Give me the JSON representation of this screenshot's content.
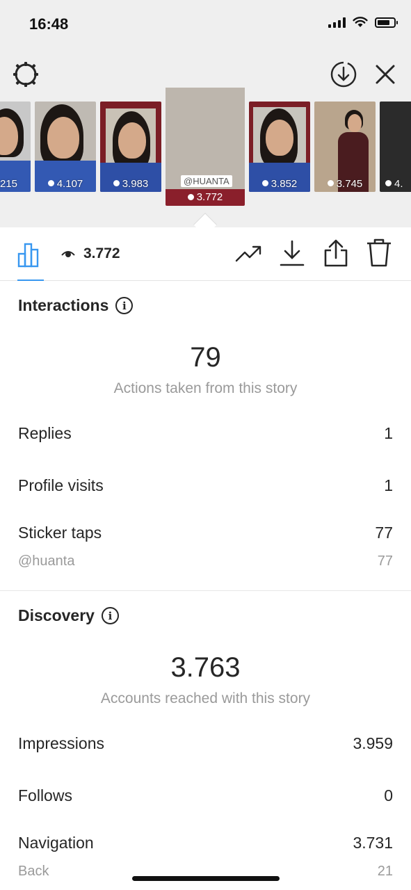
{
  "status_bar": {
    "time": "16:48"
  },
  "stories": [
    {
      "views": "215"
    },
    {
      "views": "4.107"
    },
    {
      "views": "3.983"
    },
    {
      "views": "3.772",
      "tag": "@HUANTA"
    },
    {
      "views": "3.852"
    },
    {
      "views": "3.745"
    },
    {
      "views": "4."
    }
  ],
  "toolbar": {
    "view_count": "3.772"
  },
  "interactions": {
    "title": "Interactions",
    "total": "79",
    "caption": "Actions taken from this story",
    "rows": [
      {
        "label": "Replies",
        "value": "1"
      },
      {
        "label": "Profile visits",
        "value": "1"
      },
      {
        "label": "Sticker taps",
        "value": "77"
      }
    ],
    "sub_rows": [
      {
        "label": "@huanta",
        "value": "77"
      }
    ]
  },
  "discovery": {
    "title": "Discovery",
    "total": "3.763",
    "caption": "Accounts reached with this story",
    "rows": [
      {
        "label": "Impressions",
        "value": "3.959"
      },
      {
        "label": "Follows",
        "value": "0"
      },
      {
        "label": "Navigation",
        "value": "3.731"
      }
    ],
    "sub_rows": [
      {
        "label": "Back",
        "value": "21"
      }
    ]
  },
  "colors": {
    "accent": "#3897f0",
    "selected_story_frame": "#8a1f2b",
    "header_bg": "#efefef"
  }
}
